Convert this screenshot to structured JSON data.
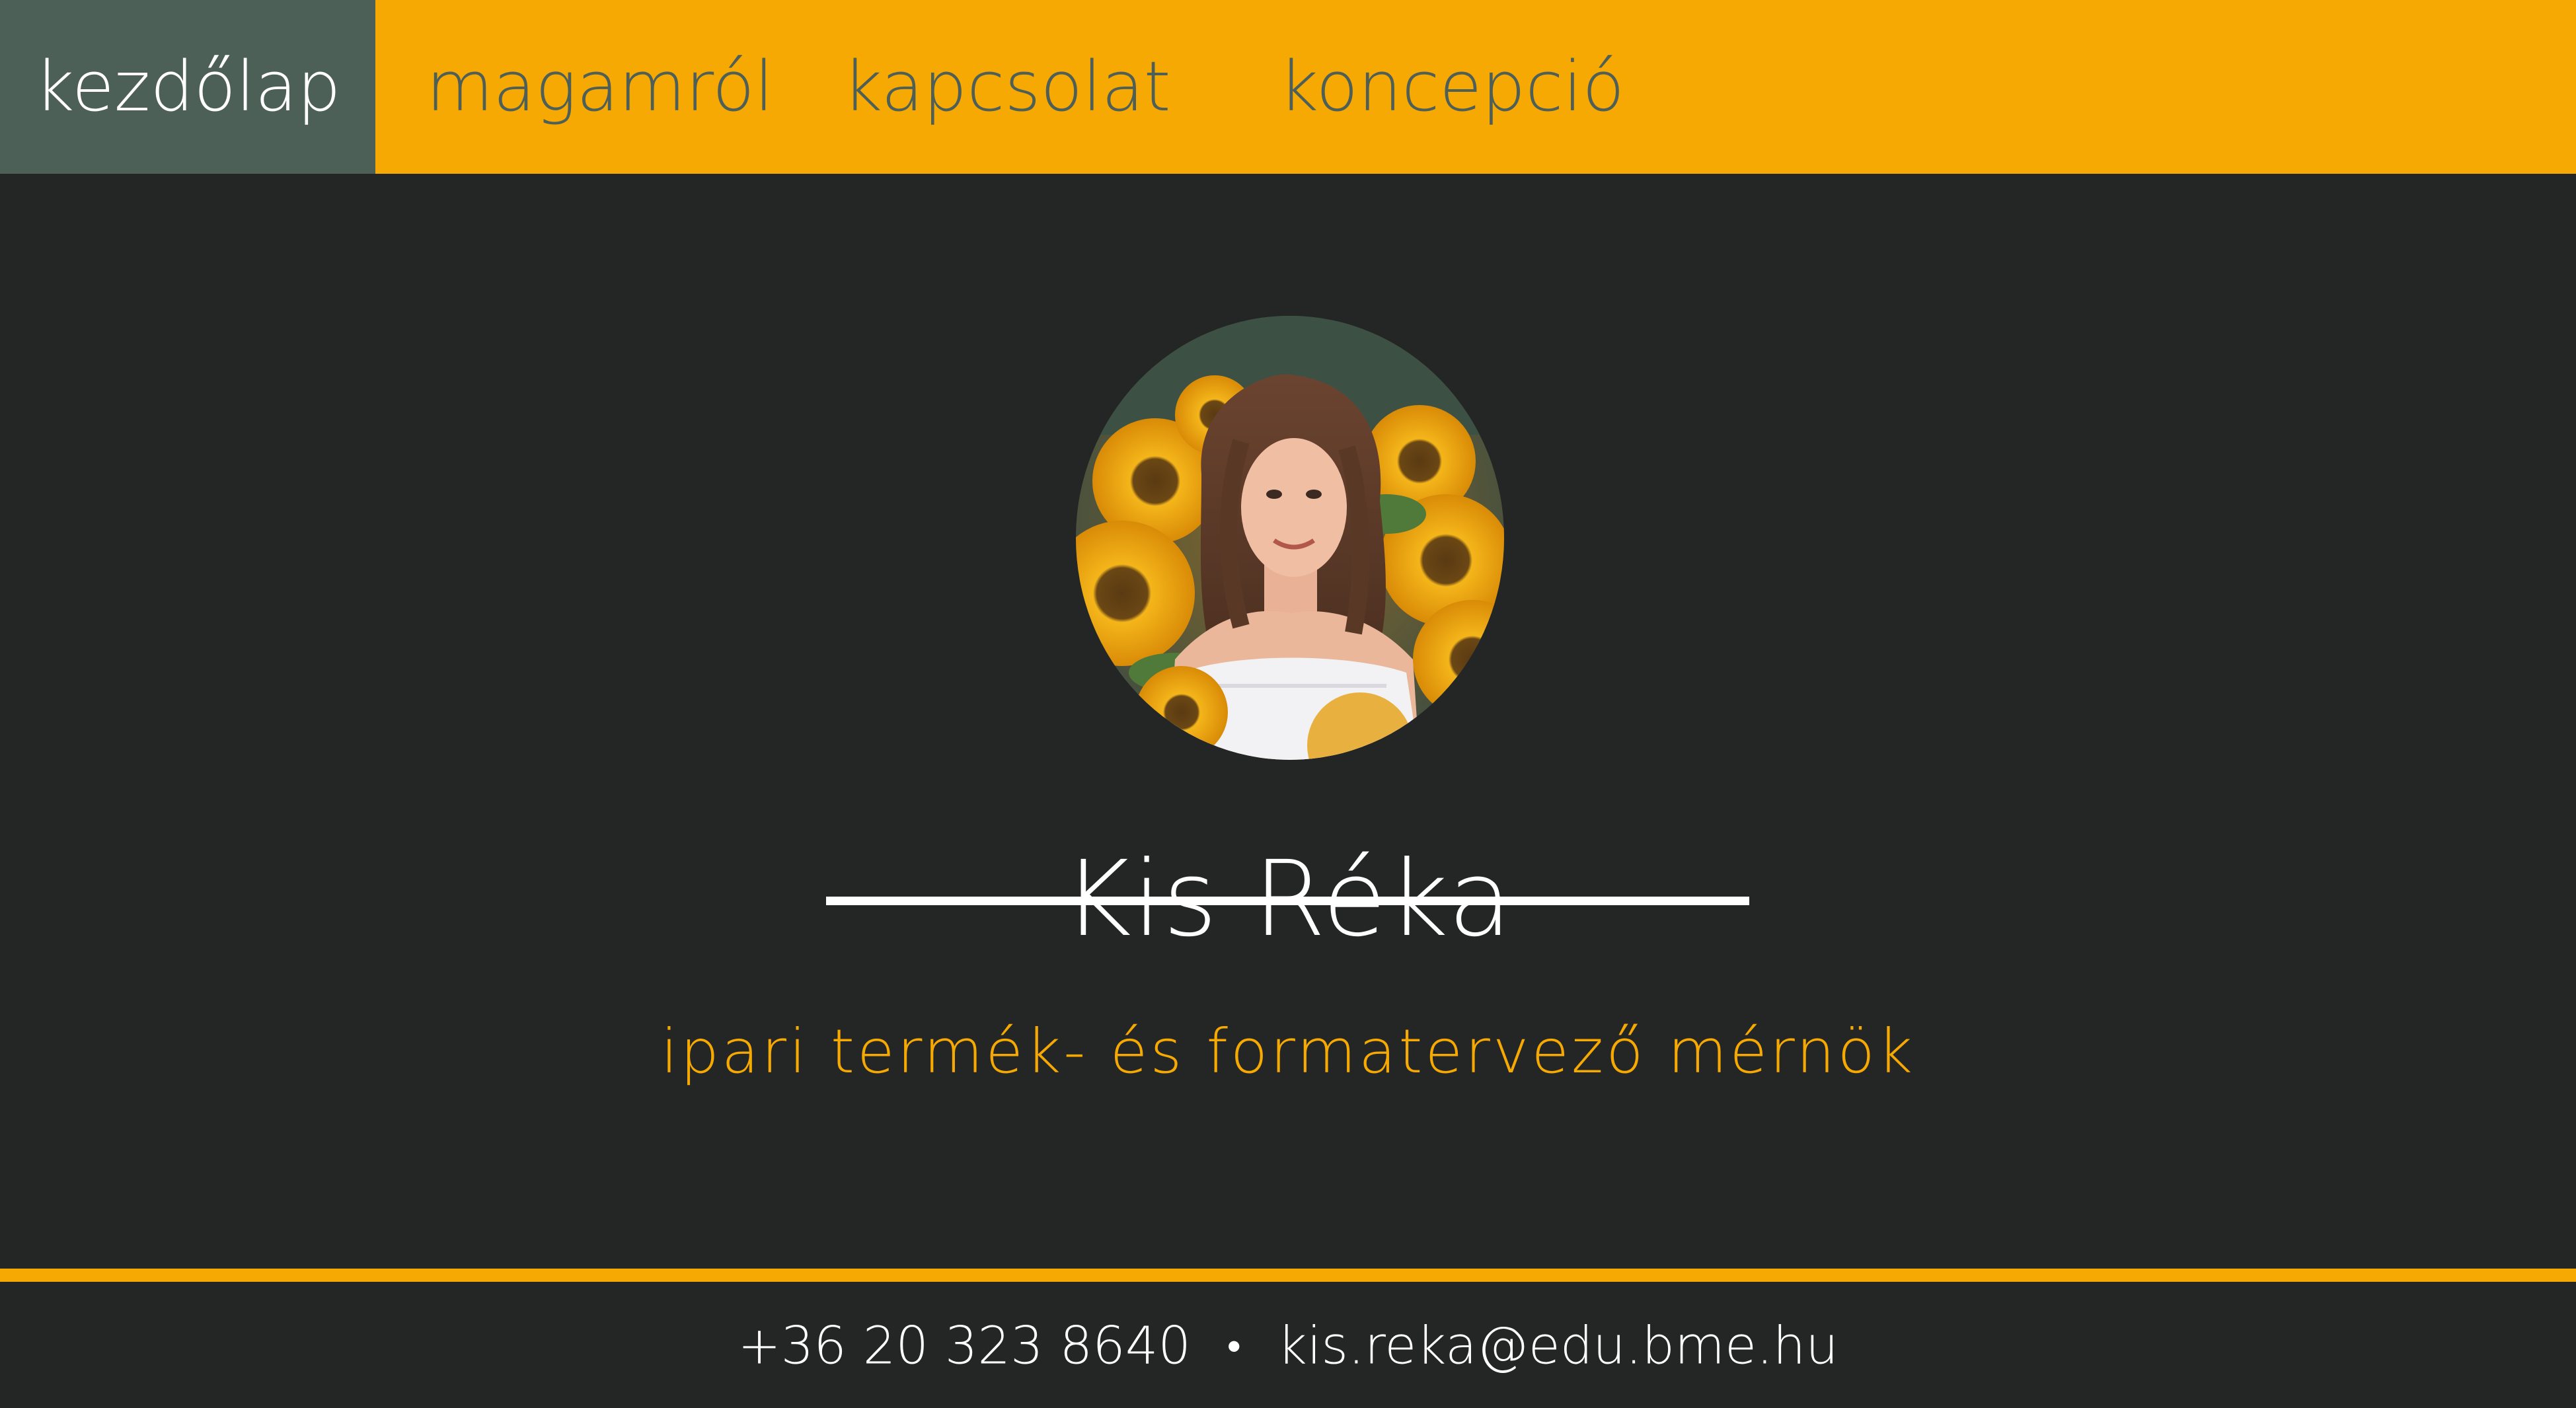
{
  "nav": {
    "items": [
      {
        "label": "kezdőlap",
        "active": true
      },
      {
        "label": "magamról",
        "active": false
      },
      {
        "label": "kapcsolat",
        "active": false
      },
      {
        "label": "koncepció",
        "active": false
      }
    ]
  },
  "hero": {
    "name": "Kis Réka",
    "subtitle": "ipari termék- és formatervező mérnök",
    "photo_alt": "portrait of a smiling woman among sunflowers"
  },
  "footer": {
    "phone": "+36 20 323 8640",
    "separator": "•",
    "email": "kis.reka@edu.bme.hu"
  },
  "colors": {
    "accent": "#f6a803",
    "nav_active": "#4c6058",
    "nav_text": "#4d5f57",
    "background": "#242625",
    "text": "#ffffff"
  }
}
